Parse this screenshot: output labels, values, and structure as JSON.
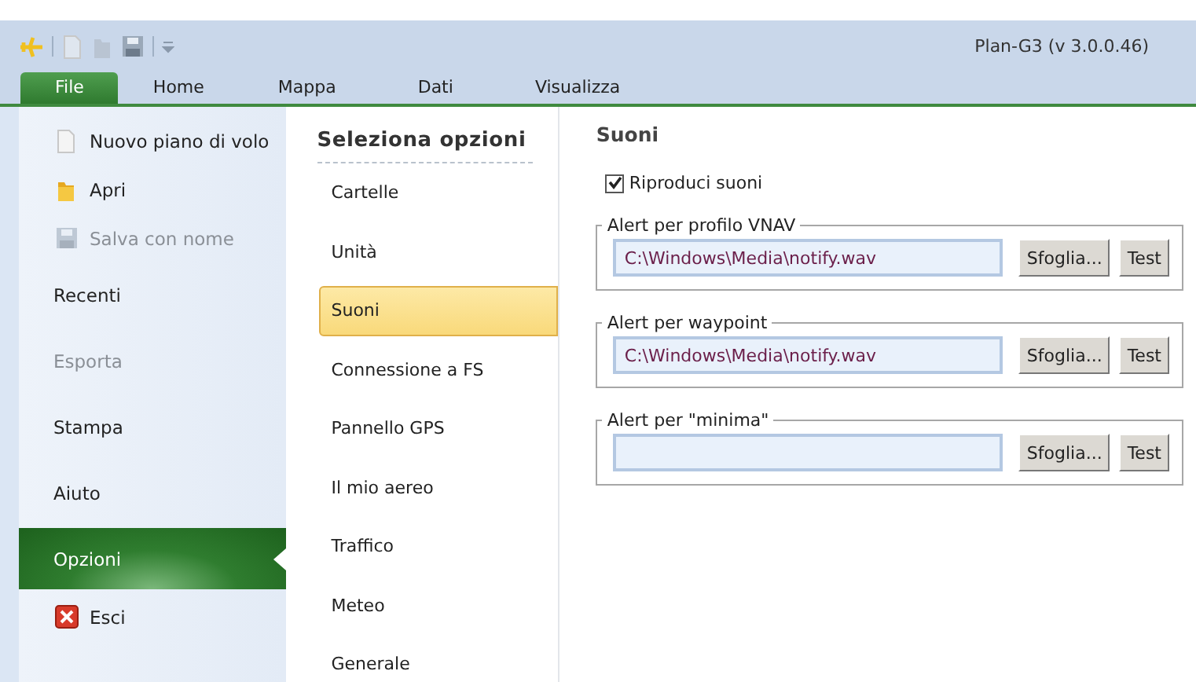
{
  "window": {
    "title": "Plan-G3 (v 3.0.0.46)"
  },
  "ribbon_tabs": [
    {
      "label": "File",
      "selected": true
    },
    {
      "label": "Home",
      "selected": false
    },
    {
      "label": "Mappa",
      "selected": false
    },
    {
      "label": "Dati",
      "selected": false
    },
    {
      "label": "Visualizza",
      "selected": false
    }
  ],
  "backstage_menu": [
    {
      "label": "Nuovo piano di volo",
      "kind": "command",
      "disabled": false,
      "selected": false
    },
    {
      "label": "Apri",
      "kind": "command",
      "disabled": false,
      "selected": false
    },
    {
      "label": "Salva con nome",
      "kind": "command",
      "disabled": true,
      "selected": false
    },
    {
      "label": "Recenti",
      "kind": "page",
      "disabled": false,
      "selected": false
    },
    {
      "label": "Esporta",
      "kind": "page",
      "disabled": true,
      "selected": false
    },
    {
      "label": "Stampa",
      "kind": "page",
      "disabled": false,
      "selected": false
    },
    {
      "label": "Aiuto",
      "kind": "page",
      "disabled": false,
      "selected": false
    },
    {
      "label": "Opzioni",
      "kind": "page",
      "disabled": false,
      "selected": true
    },
    {
      "label": "Esci",
      "kind": "command",
      "disabled": false,
      "selected": false
    }
  ],
  "options": {
    "heading": "Seleziona opzioni",
    "items": [
      {
        "label": "Cartelle",
        "selected": false
      },
      {
        "label": "Unità",
        "selected": false
      },
      {
        "label": "Suoni",
        "selected": true
      },
      {
        "label": "Connessione a FS",
        "selected": false
      },
      {
        "label": "Pannello GPS",
        "selected": false
      },
      {
        "label": "Il mio aereo",
        "selected": false
      },
      {
        "label": "Traffico",
        "selected": false
      },
      {
        "label": "Meteo",
        "selected": false
      },
      {
        "label": "Generale",
        "selected": false
      }
    ]
  },
  "panel": {
    "title": "Suoni",
    "checkbox": {
      "label": "Riproduci suoni",
      "checked": true
    },
    "groups": [
      {
        "legend": "Alert per profilo VNAV",
        "value": "C:\\Windows\\Media\\notify.wav",
        "buttons": [
          "Sfoglia...",
          "Test"
        ]
      },
      {
        "legend": "Alert per waypoint",
        "value": "C:\\Windows\\Media\\notify.wav",
        "buttons": [
          "Sfoglia...",
          "Test"
        ]
      },
      {
        "legend": "Alert per \"minima\"",
        "buttons": [
          "Sfoglia...",
          "Test"
        ]
      }
    ]
  }
}
